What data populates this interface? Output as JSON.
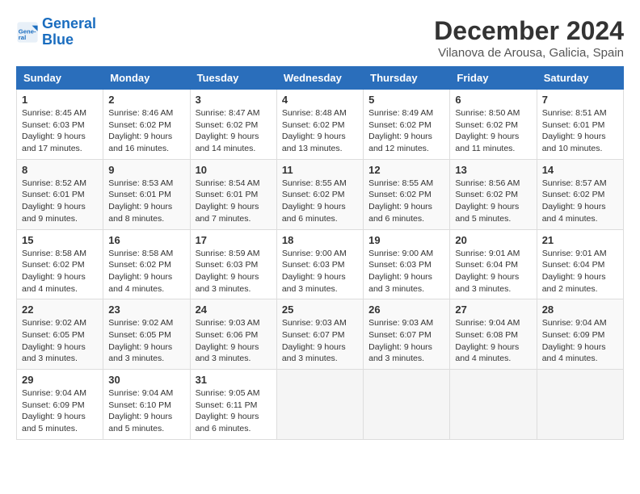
{
  "header": {
    "logo_line1": "General",
    "logo_line2": "Blue",
    "month": "December 2024",
    "location": "Vilanova de Arousa, Galicia, Spain"
  },
  "days_of_week": [
    "Sunday",
    "Monday",
    "Tuesday",
    "Wednesday",
    "Thursday",
    "Friday",
    "Saturday"
  ],
  "weeks": [
    [
      {
        "day": "1",
        "sunrise": "8:45 AM",
        "sunset": "6:03 PM",
        "daylight": "9 hours and 17 minutes."
      },
      {
        "day": "2",
        "sunrise": "8:46 AM",
        "sunset": "6:02 PM",
        "daylight": "9 hours and 16 minutes."
      },
      {
        "day": "3",
        "sunrise": "8:47 AM",
        "sunset": "6:02 PM",
        "daylight": "9 hours and 14 minutes."
      },
      {
        "day": "4",
        "sunrise": "8:48 AM",
        "sunset": "6:02 PM",
        "daylight": "9 hours and 13 minutes."
      },
      {
        "day": "5",
        "sunrise": "8:49 AM",
        "sunset": "6:02 PM",
        "daylight": "9 hours and 12 minutes."
      },
      {
        "day": "6",
        "sunrise": "8:50 AM",
        "sunset": "6:02 PM",
        "daylight": "9 hours and 11 minutes."
      },
      {
        "day": "7",
        "sunrise": "8:51 AM",
        "sunset": "6:01 PM",
        "daylight": "9 hours and 10 minutes."
      }
    ],
    [
      {
        "day": "8",
        "sunrise": "8:52 AM",
        "sunset": "6:01 PM",
        "daylight": "9 hours and 9 minutes."
      },
      {
        "day": "9",
        "sunrise": "8:53 AM",
        "sunset": "6:01 PM",
        "daylight": "9 hours and 8 minutes."
      },
      {
        "day": "10",
        "sunrise": "8:54 AM",
        "sunset": "6:01 PM",
        "daylight": "9 hours and 7 minutes."
      },
      {
        "day": "11",
        "sunrise": "8:55 AM",
        "sunset": "6:02 PM",
        "daylight": "9 hours and 6 minutes."
      },
      {
        "day": "12",
        "sunrise": "8:55 AM",
        "sunset": "6:02 PM",
        "daylight": "9 hours and 6 minutes."
      },
      {
        "day": "13",
        "sunrise": "8:56 AM",
        "sunset": "6:02 PM",
        "daylight": "9 hours and 5 minutes."
      },
      {
        "day": "14",
        "sunrise": "8:57 AM",
        "sunset": "6:02 PM",
        "daylight": "9 hours and 4 minutes."
      }
    ],
    [
      {
        "day": "15",
        "sunrise": "8:58 AM",
        "sunset": "6:02 PM",
        "daylight": "9 hours and 4 minutes."
      },
      {
        "day": "16",
        "sunrise": "8:58 AM",
        "sunset": "6:02 PM",
        "daylight": "9 hours and 4 minutes."
      },
      {
        "day": "17",
        "sunrise": "8:59 AM",
        "sunset": "6:03 PM",
        "daylight": "9 hours and 3 minutes."
      },
      {
        "day": "18",
        "sunrise": "9:00 AM",
        "sunset": "6:03 PM",
        "daylight": "9 hours and 3 minutes."
      },
      {
        "day": "19",
        "sunrise": "9:00 AM",
        "sunset": "6:03 PM",
        "daylight": "9 hours and 3 minutes."
      },
      {
        "day": "20",
        "sunrise": "9:01 AM",
        "sunset": "6:04 PM",
        "daylight": "9 hours and 3 minutes."
      },
      {
        "day": "21",
        "sunrise": "9:01 AM",
        "sunset": "6:04 PM",
        "daylight": "9 hours and 2 minutes."
      }
    ],
    [
      {
        "day": "22",
        "sunrise": "9:02 AM",
        "sunset": "6:05 PM",
        "daylight": "9 hours and 3 minutes."
      },
      {
        "day": "23",
        "sunrise": "9:02 AM",
        "sunset": "6:05 PM",
        "daylight": "9 hours and 3 minutes."
      },
      {
        "day": "24",
        "sunrise": "9:03 AM",
        "sunset": "6:06 PM",
        "daylight": "9 hours and 3 minutes."
      },
      {
        "day": "25",
        "sunrise": "9:03 AM",
        "sunset": "6:07 PM",
        "daylight": "9 hours and 3 minutes."
      },
      {
        "day": "26",
        "sunrise": "9:03 AM",
        "sunset": "6:07 PM",
        "daylight": "9 hours and 3 minutes."
      },
      {
        "day": "27",
        "sunrise": "9:04 AM",
        "sunset": "6:08 PM",
        "daylight": "9 hours and 4 minutes."
      },
      {
        "day": "28",
        "sunrise": "9:04 AM",
        "sunset": "6:09 PM",
        "daylight": "9 hours and 4 minutes."
      }
    ],
    [
      {
        "day": "29",
        "sunrise": "9:04 AM",
        "sunset": "6:09 PM",
        "daylight": "9 hours and 5 minutes."
      },
      {
        "day": "30",
        "sunrise": "9:04 AM",
        "sunset": "6:10 PM",
        "daylight": "9 hours and 5 minutes."
      },
      {
        "day": "31",
        "sunrise": "9:05 AM",
        "sunset": "6:11 PM",
        "daylight": "9 hours and 6 minutes."
      },
      null,
      null,
      null,
      null
    ]
  ]
}
